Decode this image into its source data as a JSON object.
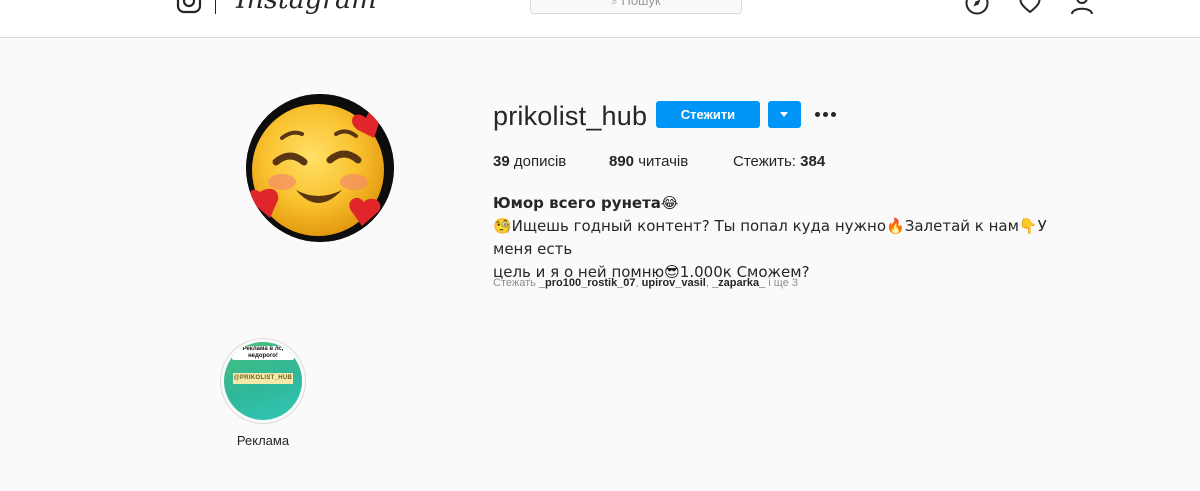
{
  "nav": {
    "wordmark": "Instagram",
    "search_placeholder": "Пошук",
    "icons": [
      "instagram-glyph-icon",
      "explore-compass-icon",
      "heart-icon",
      "profile-icon"
    ]
  },
  "profile": {
    "username": "prikolist_hub",
    "follow_label": "Стежити",
    "stats": {
      "posts_count": "39",
      "posts_label": "дописів",
      "followers_count": "890",
      "followers_label": "читачів",
      "following_label": "Стежить:",
      "following_count": "384"
    },
    "bio_name": "Юмор всего рунета😂",
    "bio_line1": "🧐Ищешь годный контент? Ты попал куда нужно🔥Залетай к нам👇У меня есть",
    "bio_line2": "цель и я о ней помню😎1.000к Сможем?",
    "followed_by": {
      "prefix": "Стежать",
      "accounts": [
        "_pro100_rostik_07",
        "upirov_vasil",
        "_zaparka_"
      ],
      "suffix": "і ще 3"
    }
  },
  "highlights": [
    {
      "label": "Реклама",
      "note": "Реклама в лс, недорого!",
      "tag": "@PRIKOLIST_HUB"
    }
  ],
  "colors": {
    "accent": "#0095f6",
    "background": "#fafafa",
    "text": "#262626",
    "muted": "#8e8e8e",
    "border": "#dbdbdb"
  }
}
